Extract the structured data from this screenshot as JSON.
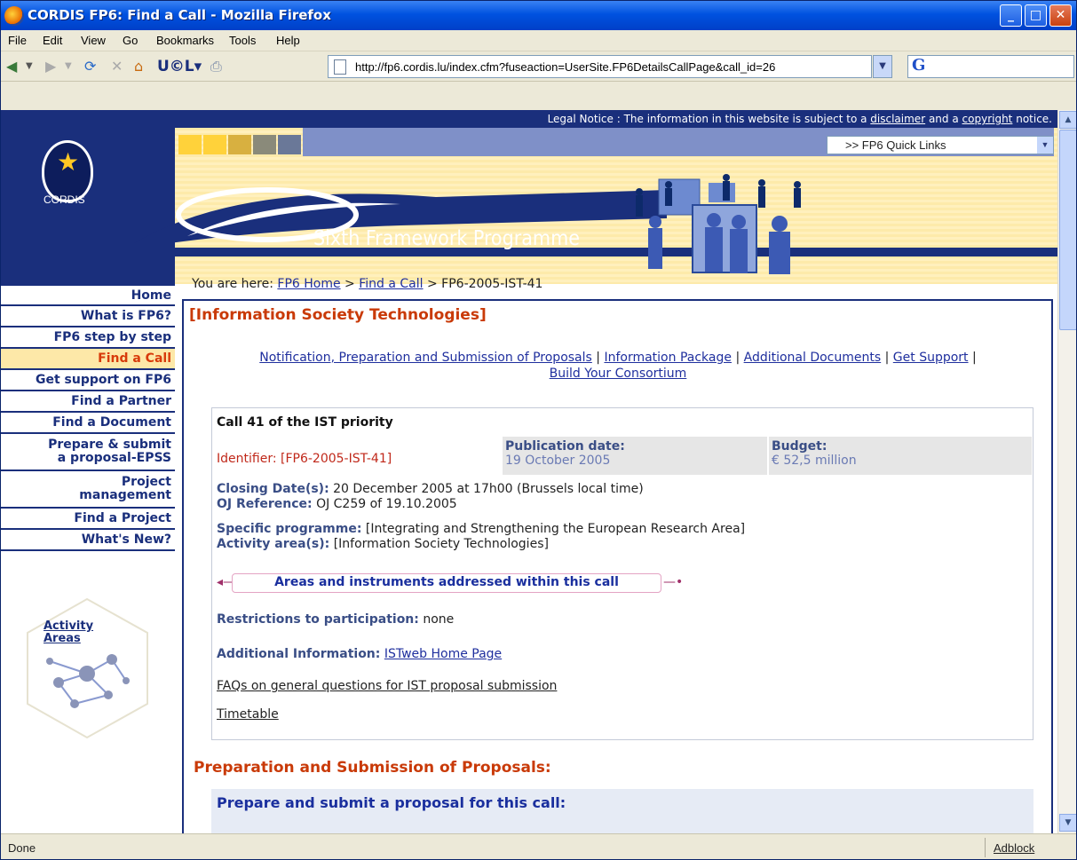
{
  "window": {
    "title": "CORDIS FP6: Find a Call - Mozilla Firefox"
  },
  "menu": [
    "File",
    "Edit",
    "View",
    "Go",
    "Bookmarks",
    "Tools",
    "Help"
  ],
  "url": "http://fp6.cordis.lu/index.cfm?fuseaction=UserSite.FP6DetailsCallPage&call_id=26",
  "status": {
    "left": "Done",
    "right": "Adblock"
  },
  "page": {
    "legal_prefix": "Legal Notice : The information in this website is subject to a",
    "legal_link1": "disclaimer",
    "legal_mid": "and a",
    "legal_link2": "copyright",
    "legal_suffix": "notice.",
    "cordis_label": "CORDIS",
    "quick_links": ">> FP6 Quick Links",
    "programme_title": "Sixth Framework Programme",
    "crumb_prefix": "You are here:",
    "crumb_home": "FP6 Home",
    "crumb_sep1": ">",
    "crumb_find": "Find a Call",
    "crumb_sep2": ">",
    "crumb_current": "FP6-2005-IST-41",
    "nav": [
      {
        "label": "Home"
      },
      {
        "label": "What is FP6?"
      },
      {
        "label": "FP6 step by step"
      },
      {
        "label": "Find a Call"
      },
      {
        "label": "Get support on FP6"
      },
      {
        "label": "Find a Partner"
      },
      {
        "label": "Find a Document"
      },
      {
        "label": "Prepare & submit",
        "label2": "a proposal-EPSS"
      },
      {
        "label": "Project",
        "label2": "management"
      },
      {
        "label": "Find a Project"
      },
      {
        "label": "What's New?"
      }
    ],
    "activity_l1": "Activity",
    "activity_l2": "Areas",
    "section_title": "[Information Society Technologies]",
    "links": {
      "l1": "Notification, Preparation and Submission of Proposals",
      "sep": "|",
      "l2": "Information Package",
      "l3": "Additional Documents",
      "l4": "Get Support",
      "l5": "Build Your Consortium"
    },
    "call": {
      "title": "Call 41 of the IST priority",
      "identifier": "Identifier: [FP6-2005-IST-41]",
      "pub_label": "Publication date:",
      "pub_value": "19 October 2005",
      "budget_label": "Budget:",
      "budget_value": "€ 52,5 million",
      "closing_label": "Closing Date(s):",
      "closing_value": "20 December 2005 at 17h00 (Brussels local time)",
      "oj_label": "OJ Reference:",
      "oj_value": "OJ C259 of 19.10.2005",
      "specific_label": "Specific programme:",
      "specific_value": "[Integrating and Strengthening the European Research Area]",
      "activity_label": "Activity area(s):",
      "activity_value": "[Information Society Technologies]",
      "areas_button": "Areas and instruments addressed within this call",
      "restrictions_label": "Restrictions to participation:",
      "restrictions_value": "none",
      "addinfo_label": "Additional Information:",
      "addinfo_link": "ISTweb Home Page",
      "faq_link": "FAQs on general questions for IST proposal submission",
      "timetable_link": "Timetable"
    },
    "prep_heading": "Preparation and Submission of Proposals:",
    "prep_box_title": "Prepare and submit a proposal for this call:"
  },
  "colors": {
    "accent": "#1a2f7c",
    "orange": "#c93a08",
    "highlight": "#fde8a8"
  }
}
